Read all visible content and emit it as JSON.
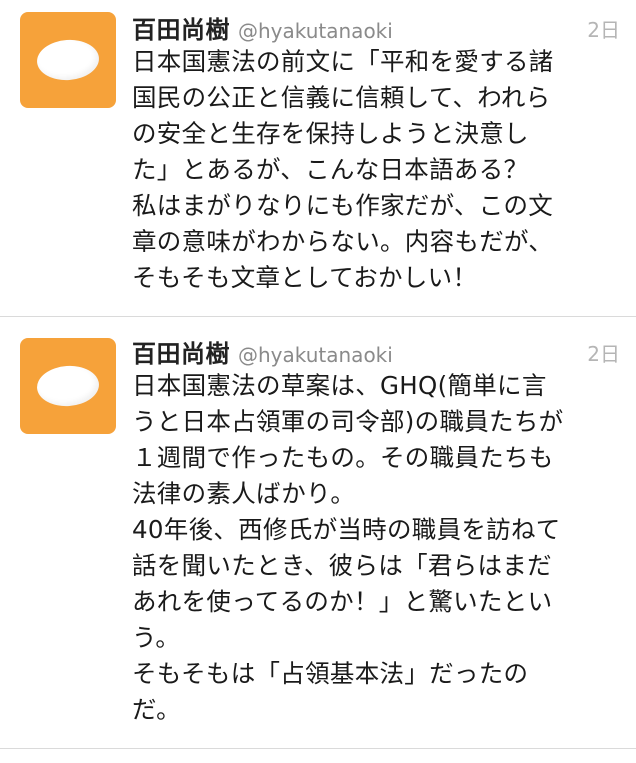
{
  "tweets": [
    {
      "name": "百田尚樹",
      "handle": "@hyakutanaoki",
      "time": "2日",
      "text": "日本国憲法の前文に「平和を愛する諸\n国民の公正と信義に信頼して、われら\nの安全と生存を保持しようと決意し\nた」とあるが、こんな日本語ある？\n私はまがりなりにも作家だが、この文\n章の意味がわからない。内容もだが、\nそもそも文章としておかしい！"
    },
    {
      "name": "百田尚樹",
      "handle": "@hyakutanaoki",
      "time": "2日",
      "text": "日本国憲法の草案は、GHQ(簡単に言\nうと日本占領軍の司令部)の職員たちが\n１週間で作ったもの。その職員たちも\n法律の素人ばかり。\n40年後、西修氏が当時の職員を訪ねて\n話を聞いたとき、彼らは「君らはまだ\nあれを使ってるのか！」と驚いたとい\nう。\nそもそもは「占領基本法」だったの\nだ。"
    }
  ],
  "colors": {
    "avatar_bg": "#f6a23a",
    "name": "#222222",
    "handle": "#8a8a8a",
    "time": "#b5b5b5",
    "divider": "#dadada"
  },
  "icons": {
    "avatar": "default-egg-avatar-icon"
  }
}
